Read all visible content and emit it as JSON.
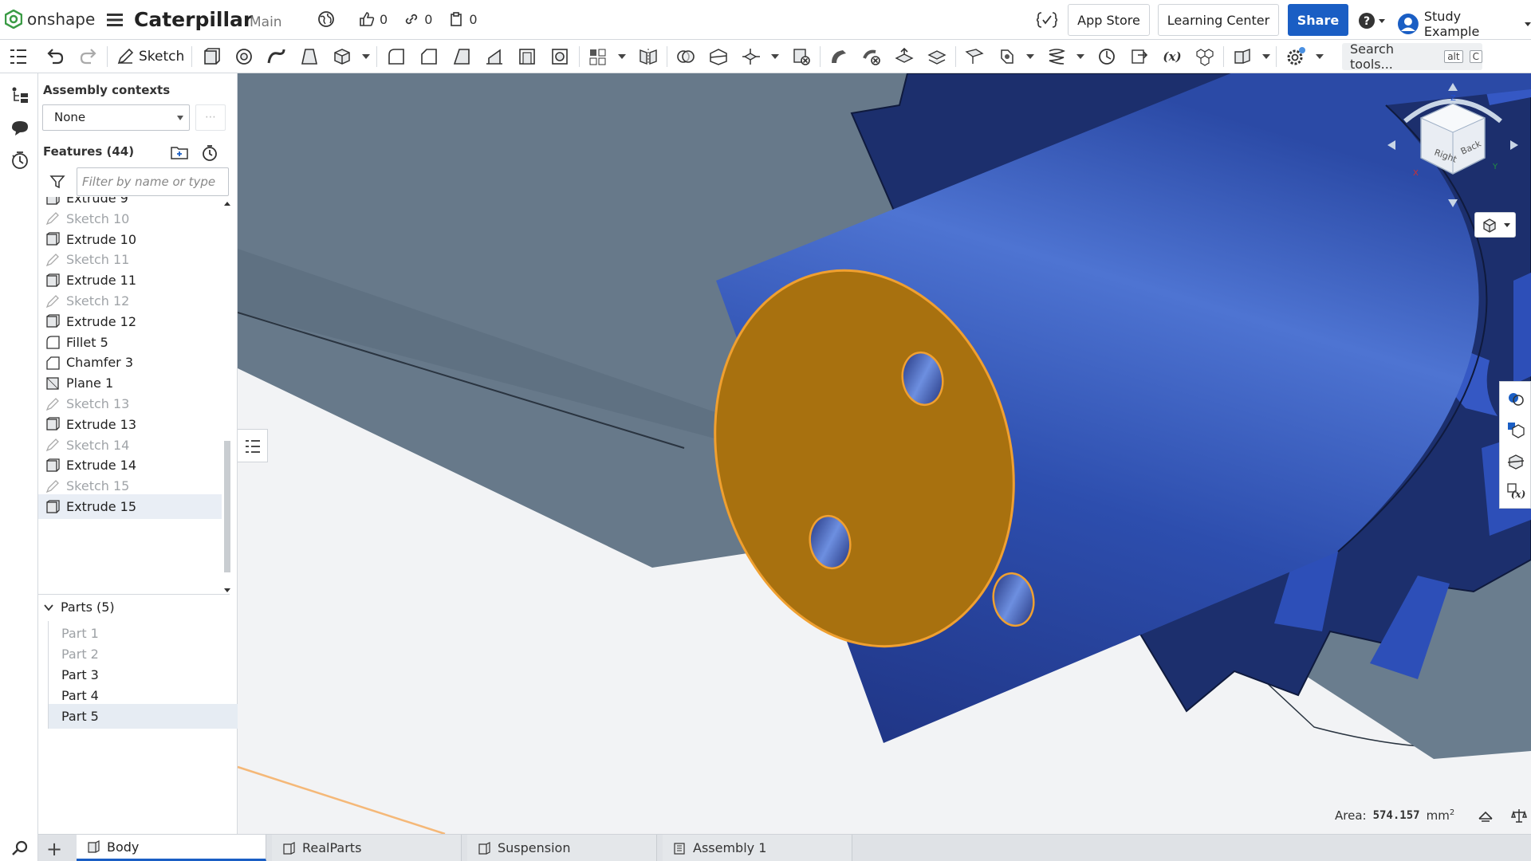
{
  "app": {
    "brand": "onshape"
  },
  "document": {
    "title": "Caterpillar",
    "branch": "Main"
  },
  "counters": {
    "likes": "0",
    "links": "0",
    "copies": "0"
  },
  "top_buttons": {
    "app_store": "App Store",
    "learning_center": "Learning Center",
    "share": "Share",
    "user_name": "Study Example"
  },
  "toolbar": {
    "sketch_label": "Sketch",
    "search_placeholder": "Search tools...",
    "shortcut_key1": "alt",
    "shortcut_key2": "C"
  },
  "panel": {
    "contexts_title": "Assembly contexts",
    "context_value": "None",
    "features_title": "Features (44)",
    "filter_placeholder": "Filter by name or type",
    "features": [
      {
        "label": "Extrude 9",
        "kind": "extrude",
        "dim": false
      },
      {
        "label": "Sketch 10",
        "kind": "sketch",
        "dim": true
      },
      {
        "label": "Extrude 10",
        "kind": "extrude",
        "dim": false
      },
      {
        "label": "Sketch 11",
        "kind": "sketch",
        "dim": true
      },
      {
        "label": "Extrude 11",
        "kind": "extrude",
        "dim": false
      },
      {
        "label": "Sketch 12",
        "kind": "sketch",
        "dim": true
      },
      {
        "label": "Extrude 12",
        "kind": "extrude",
        "dim": false
      },
      {
        "label": "Fillet 5",
        "kind": "fillet",
        "dim": false
      },
      {
        "label": "Chamfer 3",
        "kind": "chamfer",
        "dim": false
      },
      {
        "label": "Plane 1",
        "kind": "plane",
        "dim": false
      },
      {
        "label": "Sketch 13",
        "kind": "sketch",
        "dim": true
      },
      {
        "label": "Extrude 13",
        "kind": "extrude",
        "dim": false
      },
      {
        "label": "Sketch 14",
        "kind": "sketch",
        "dim": true
      },
      {
        "label": "Extrude 14",
        "kind": "extrude",
        "dim": false
      },
      {
        "label": "Sketch 15",
        "kind": "sketch",
        "dim": true
      },
      {
        "label": "Extrude 15",
        "kind": "extrude",
        "dim": false,
        "selected": true
      }
    ],
    "parts_title": "Parts (5)",
    "parts": [
      {
        "label": "Part 1",
        "dim": true
      },
      {
        "label": "Part 2",
        "dim": true
      },
      {
        "label": "Part 3",
        "dim": false
      },
      {
        "label": "Part 4",
        "dim": false
      },
      {
        "label": "Part 5",
        "dim": false,
        "selected": true
      }
    ]
  },
  "viewcube": {
    "right": "Right",
    "back": "Back",
    "z": "Z",
    "x": "X",
    "y": "Y"
  },
  "measure": {
    "label": "Area:",
    "value": "574.157",
    "unit": "mm"
  },
  "tabs": [
    {
      "label": "Body",
      "active": true
    },
    {
      "label": "RealParts",
      "active": false
    },
    {
      "label": "Suspension",
      "active": false
    },
    {
      "label": "Assembly 1",
      "active": false
    }
  ],
  "colors": {
    "accent": "#1a5ec4",
    "part_blue": "#2f4fb0",
    "face_selected": "#b07614",
    "background_grey": "#6d7f8e"
  }
}
